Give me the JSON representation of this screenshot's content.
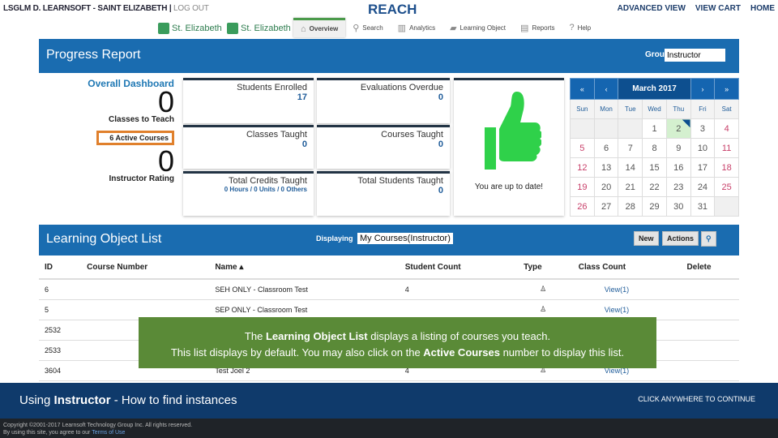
{
  "topbar": {
    "user": "LSGLM D. LEARNSOFT - SAINT ELIZABETH",
    "separator": "|",
    "logout": "LOG OUT",
    "app_title": "REACH",
    "links": [
      "ADVANCED VIEW",
      "VIEW CART",
      "HOME"
    ]
  },
  "logos": [
    "St. Elizabeth",
    "St. Elizabeth"
  ],
  "nav": [
    {
      "label": "Overview",
      "icon": "home-icon",
      "active": true
    },
    {
      "label": "Search",
      "icon": "search-icon"
    },
    {
      "label": "Analytics",
      "icon": "bar-chart-icon"
    },
    {
      "label": "Learning Object",
      "icon": "book-icon"
    },
    {
      "label": "Reports",
      "icon": "document-icon"
    },
    {
      "label": "Help",
      "icon": "help-icon"
    }
  ],
  "progress": {
    "title": "Progress Report",
    "group_label": "Group",
    "group_value": "Instructor"
  },
  "dashboard": {
    "title": "Overall Dashboard",
    "classes_to_teach": "0",
    "classes_to_teach_label": "Classes to Teach",
    "active_courses": "6 Active Courses",
    "instructor_rating": "0",
    "instructor_rating_label": "Instructor Rating",
    "cards": [
      {
        "label": "Students Enrolled",
        "value": "17"
      },
      {
        "label": "Evaluations Overdue",
        "value": "0"
      },
      {
        "label": "Classes Taught",
        "value": "0"
      },
      {
        "label": "Courses Taught",
        "value": "0"
      },
      {
        "label": "Total Credits Taught",
        "value": "0 Hours / 0 Units / 0 Others"
      },
      {
        "label": "Total Students Taught",
        "value": "0"
      }
    ],
    "thumbs_text": "You are up to date!"
  },
  "calendar": {
    "prev_year": "«",
    "prev": "‹",
    "month": "March  2017",
    "next": "›",
    "next_year": "»",
    "weekdays": [
      "Sun",
      "Mon",
      "Tue",
      "Wed",
      "Thu",
      "Fri",
      "Sat"
    ],
    "weeks": [
      [
        "",
        "",
        "",
        "1",
        "2",
        "3",
        "4"
      ],
      [
        "5",
        "6",
        "7",
        "8",
        "9",
        "10",
        "11"
      ],
      [
        "12",
        "13",
        "14",
        "15",
        "16",
        "17",
        "18"
      ],
      [
        "19",
        "20",
        "21",
        "22",
        "23",
        "24",
        "25"
      ],
      [
        "26",
        "27",
        "28",
        "29",
        "30",
        "31",
        ""
      ]
    ],
    "today": "2"
  },
  "lol": {
    "title": "Learning Object List",
    "displaying_label": "Displaying",
    "displaying_value": "My Courses(Instructor)",
    "new": "New",
    "actions": "Actions",
    "columns": [
      "ID",
      "Course Number",
      "Name ▴",
      "Student Count",
      "Type",
      "Class Count",
      "Delete"
    ],
    "rows": [
      [
        "6",
        "",
        "SEH ONLY - Classroom Test",
        "4",
        "",
        "View(1)",
        ""
      ],
      [
        "5",
        "",
        "SEP ONLY - Classroom Test",
        "",
        "",
        "View(1)",
        ""
      ],
      [
        "2532",
        "",
        "",
        "",
        "",
        "",
        ""
      ],
      [
        "2533",
        "",
        "",
        "",
        "",
        "",
        ""
      ],
      [
        "3604",
        "",
        "Test Joel 2",
        "4",
        "",
        "View(1)",
        ""
      ]
    ]
  },
  "tip": {
    "line1_pre": "The ",
    "line1_bold": "Learning Object List",
    "line1_post": " displays a listing of courses you teach.",
    "line2_pre": "This list displays by default. You may also click on the ",
    "line2_bold": "Active Courses",
    "line2_post": " number to display this list."
  },
  "banner": {
    "pre": "Using ",
    "bold": "Instructor",
    "post": " - How to find instances",
    "continue": "CLICK ANYWHERE TO CONTINUE"
  },
  "footer": {
    "copyright": "Copyright ©2001-2017 Learnsoft Technology Group Inc. All rights reserved.",
    "terms_pre": "By using this site, you agree to our ",
    "terms_link": "Terms of Use"
  },
  "colors": {
    "header_blue": "#1a6cb0",
    "tip_green": "#5a8a37",
    "banner_navy": "#0f3a6b",
    "highlight_orange": "#e0802c"
  }
}
